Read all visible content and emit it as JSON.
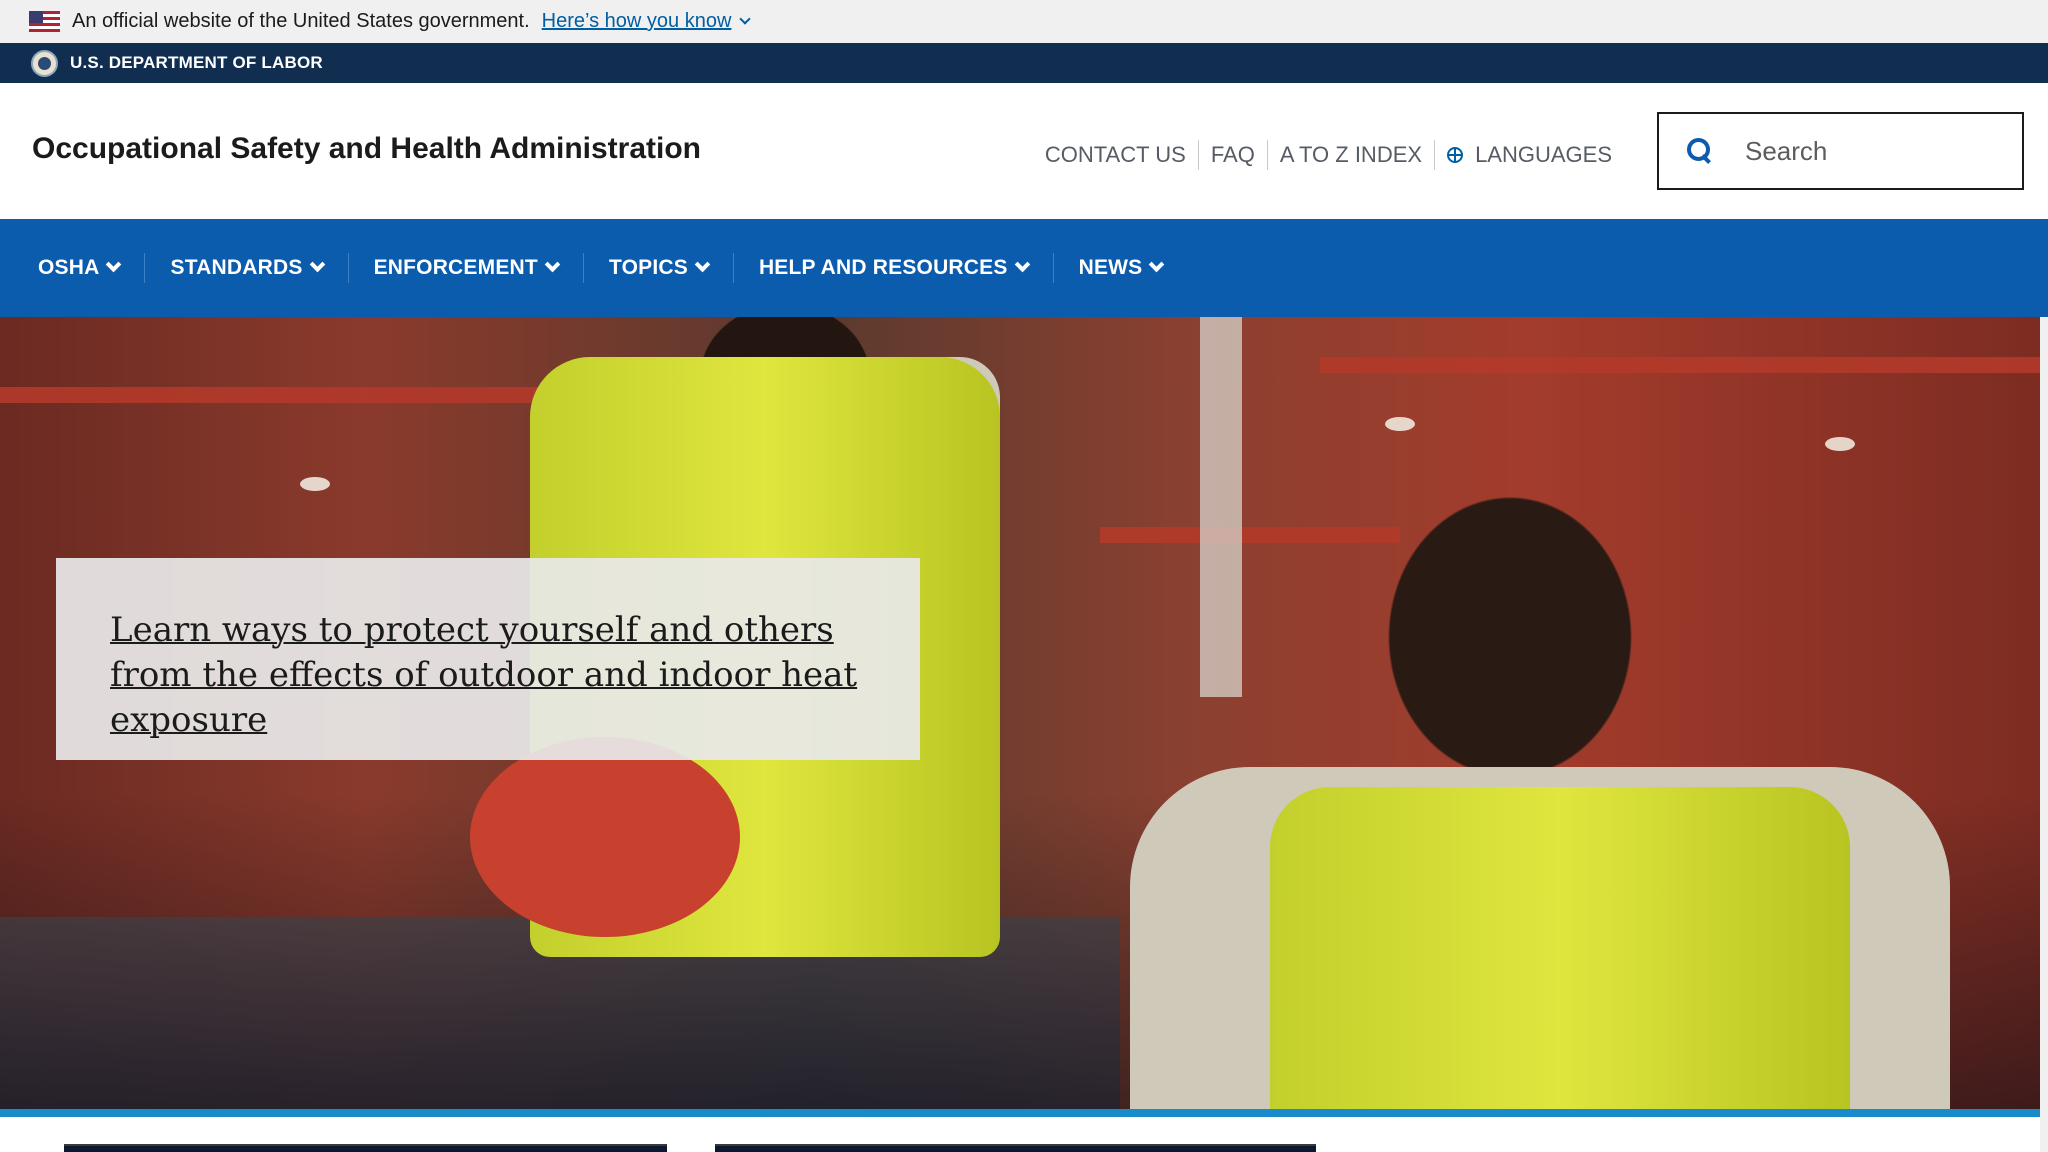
{
  "gov_banner": {
    "text": "An official website of the United States government.",
    "link": "Here’s how you know"
  },
  "agency_bar": {
    "name": "U.S. DEPARTMENT OF LABOR"
  },
  "header": {
    "site_title": "Occupational Safety and Health Administration",
    "utility_links": [
      "CONTACT US",
      "FAQ",
      "A TO Z INDEX",
      "LANGUAGES"
    ],
    "search": {
      "placeholder": "Search",
      "value": ""
    }
  },
  "main_nav": {
    "items": [
      "OSHA",
      "STANDARDS",
      "ENFORCEMENT",
      "TOPICS",
      "HELP AND RESOURCES",
      "NEWS"
    ]
  },
  "hero": {
    "headline": "Learn ways to protect yourself and others from the effects of outdoor and indoor heat exposure"
  },
  "colors": {
    "nav_blue": "#0b5cad",
    "agency_navy": "#112e51",
    "hero_accent": "#1a8bc9"
  }
}
